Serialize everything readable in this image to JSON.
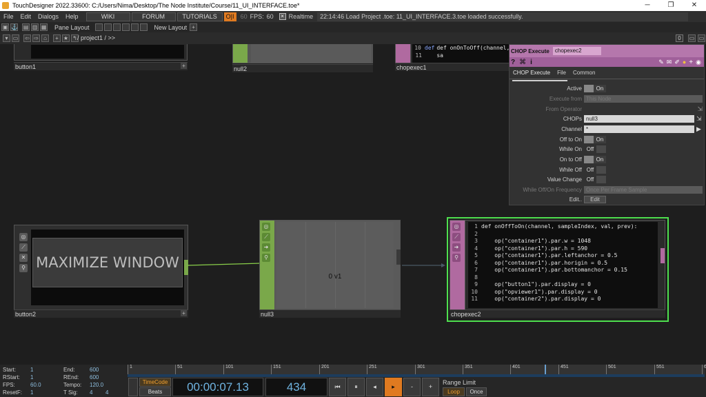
{
  "titlebar": {
    "title": "TouchDesigner 2022.33600: C:/Users/Nima/Desktop/The Node Institute/Course/11_UI_INTERFACE.toe*",
    "minimize": "─",
    "maximize": "❐",
    "close": "✕"
  },
  "menubar": {
    "file": "File",
    "edit": "Edit",
    "dialogs": "Dialogs",
    "help": "Help",
    "wiki": "WIKI",
    "forum": "FORUM",
    "tutorials": "TUTORIALS",
    "oi": "O|I",
    "fps_cap": "60",
    "fps_label": "FPS:",
    "fps_value": "60",
    "realtime": "Realtime",
    "status": "22:14:46 Load Project .toe: 11_UI_INTERFACE.3.toe loaded successfully."
  },
  "toolbar2": {
    "pane_layout": "Pane Layout",
    "new_layout": "New Layout"
  },
  "pathbar": {
    "path": "/ project1 / >>",
    "num": "0"
  },
  "nodes": {
    "button1": "button1",
    "null2": "null2",
    "chopexec1": "chopexec1",
    "button2": "button2",
    "button2_text": "MAXIMIZE WINDOW",
    "null3": "null3",
    "null3_value": "0 v1",
    "chopexec2": "chopexec2"
  },
  "chopexec1_code": [
    {
      "n": "10",
      "text": "def onOnToOff(channel, sa"
    },
    {
      "n": "11",
      "text": ""
    }
  ],
  "chopexec2_code": [
    {
      "n": "1",
      "text": "def onOffToOn(channel, sampleIndex, val, prev):"
    },
    {
      "n": "2",
      "text": ""
    },
    {
      "n": "3",
      "text": "    op(\"container1\").par.w = 1048"
    },
    {
      "n": "4",
      "text": "    op(\"container1\").par.h = 590"
    },
    {
      "n": "5",
      "text": "    op(\"container1\").par.leftanchor = 0.5"
    },
    {
      "n": "6",
      "text": "    op(\"container1\").par.horigin = 0.5"
    },
    {
      "n": "7",
      "text": "    op(\"container1\").par.bottomanchor = 0.15"
    },
    {
      "n": "8",
      "text": ""
    },
    {
      "n": "9",
      "text": "    op(\"button1\").par.display = 0"
    },
    {
      "n": "10",
      "text": "    op(\"opviewer1\").par.display = 0"
    },
    {
      "n": "11",
      "text": "    op(\"container2\").par.display = 0"
    }
  ],
  "panel": {
    "type": "CHOP Execute",
    "name": "chopexec2",
    "tabs": [
      "CHOP Execute",
      "File",
      "Common"
    ],
    "params": {
      "active": {
        "label": "Active",
        "value": "On"
      },
      "execute_from": {
        "label": "Execute from",
        "value": "This Node"
      },
      "from_operator": {
        "label": "From Operator"
      },
      "chops": {
        "label": "CHOPs",
        "value": "null3"
      },
      "channel": {
        "label": "Channel",
        "value": "*"
      },
      "off_to_on": {
        "label": "Off to On",
        "value": "On"
      },
      "while_on": {
        "label": "While On",
        "value": "Off"
      },
      "on_to_off": {
        "label": "On to Off",
        "value": "On"
      },
      "while_off": {
        "label": "While Off",
        "value": "Off"
      },
      "value_change": {
        "label": "Value Change",
        "value": "Off"
      },
      "frequency": {
        "label": "While Off/On Frequency",
        "value": "Once Per Frame Sample"
      },
      "edit": {
        "label": "Edit..",
        "value": "Edit"
      }
    }
  },
  "timeline": {
    "start_label": "Start:",
    "start": "1",
    "rstart_label": "RStart:",
    "rstart": "1",
    "fps_label": "FPS:",
    "fps": "60.0",
    "resetf_label": "ResetF:",
    "resetf": "1",
    "end_label": "End:",
    "end": "600",
    "rend_label": "REnd:",
    "rend": "600",
    "tempo_label": "Tempo:",
    "tempo": "120.0",
    "tsig_label": "T Sig:",
    "tsig_a": "4",
    "tsig_b": "4",
    "timecode": "TimeCode",
    "beats": "Beats",
    "time": "00:00:07.13",
    "frame": "434",
    "range_limit": "Range Limit",
    "loop": "Loop",
    "once": "Once",
    "ticks": [
      "1",
      "51",
      "101",
      "151",
      "201",
      "251",
      "301",
      "351",
      "401",
      "451",
      "501",
      "551",
      "600"
    ],
    "playhead_fraction": 0.723
  }
}
